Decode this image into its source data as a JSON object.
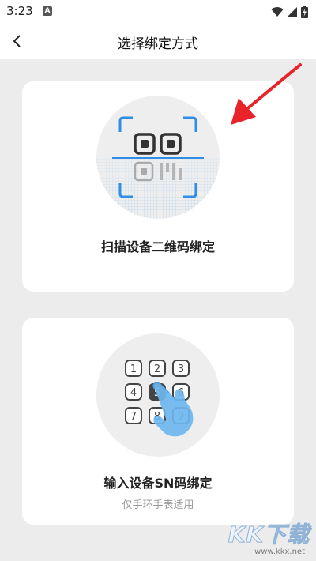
{
  "status_bar": {
    "time": "3:23",
    "notification_letter": "A",
    "icons": [
      "wifi-icon",
      "cellular-signal-icon",
      "battery-charging-icon"
    ]
  },
  "header": {
    "back_icon": "chevron-left-icon",
    "title": "选择绑定方式"
  },
  "options": {
    "qr": {
      "title": "扫描设备二维码绑定",
      "icon": "qr-scan-illustration"
    },
    "sn": {
      "title": "输入设备SN码绑定",
      "subtitle": "仅手环手表适用",
      "icon": "keypad-illustration",
      "keys": [
        "1",
        "2",
        "3",
        "4",
        "5",
        "6",
        "7",
        "8",
        "9"
      ]
    }
  },
  "watermark": {
    "main": "KK下载",
    "url": "www.kkx.net"
  },
  "colors": {
    "accent_blue": "#2f8fe6",
    "arrow_red": "#e8242a",
    "background": "#ececec"
  }
}
